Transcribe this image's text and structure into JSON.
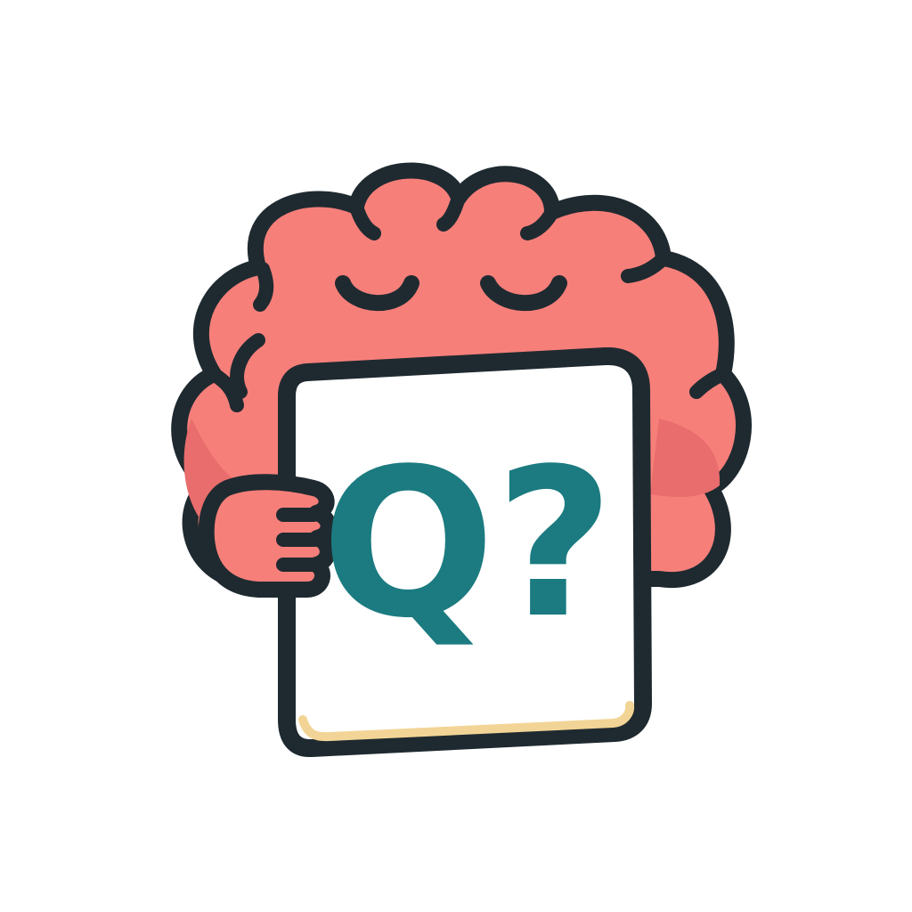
{
  "logo": {
    "card_text": "Q?",
    "icon": "brain-holding-card-icon",
    "colors": {
      "background": "#ffffff",
      "brain_fill": "#f77f7a",
      "brain_shade": "#e86d6c",
      "outline": "#1f2a30",
      "card_fill": "#ffffff",
      "card_bottom_edge": "#f2d596",
      "card_text": "#1b7b80"
    }
  }
}
